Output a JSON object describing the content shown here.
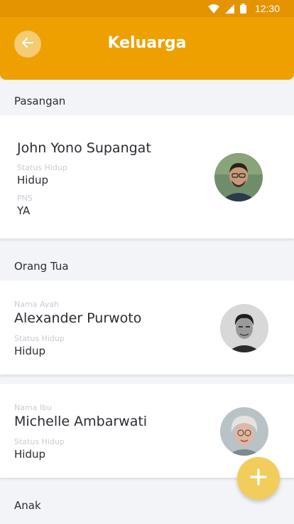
{
  "status_bar": {
    "time": "12:30",
    "icons": [
      "wifi-icon",
      "cell-signal-icon",
      "battery-icon"
    ]
  },
  "header": {
    "title": "Keluarga",
    "back_icon": "arrow-left-icon",
    "color": "#eda000"
  },
  "sections": {
    "spouse": "Pasangan",
    "parents": "Orang Tua",
    "children": "Anak"
  },
  "spouse": {
    "name": "John Yono Supangat",
    "status_label": "Status Hidup",
    "status_value": "Hidup",
    "pns_label": "PNS",
    "pns_value": "YA"
  },
  "father": {
    "label": "Nama Ayah",
    "name": "Alexander Purwoto",
    "status_label": "Status Hidup",
    "status_value": "Hidup"
  },
  "mother": {
    "label": "Nama Ibu",
    "name": "Michelle Ambarwati",
    "status_label": "Status Hidup",
    "status_value": "Hidup"
  },
  "fab": {
    "icon": "plus-icon",
    "color": "#f2cd5c"
  }
}
